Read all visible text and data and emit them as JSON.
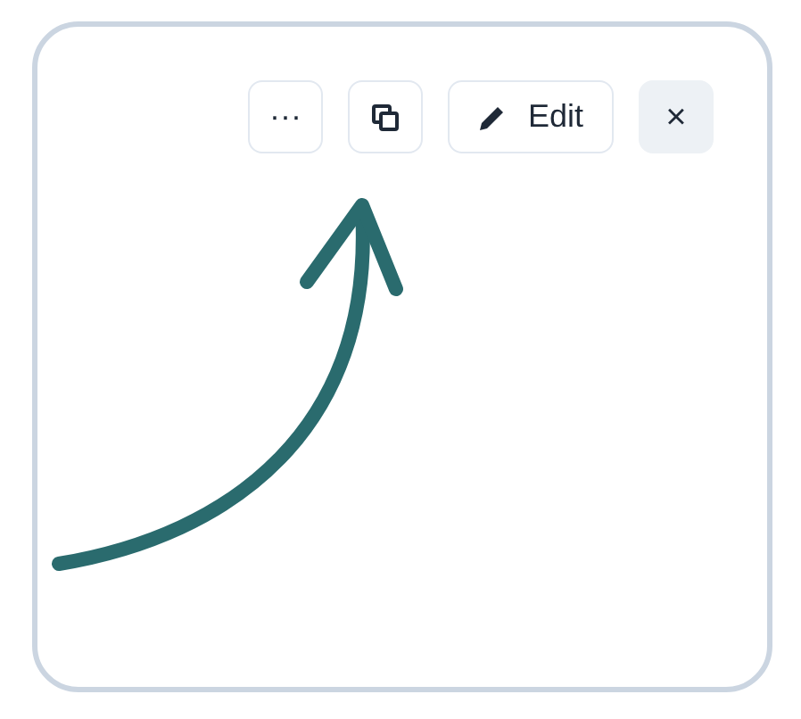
{
  "toolbar": [
    {
      "kind": "more",
      "label": "···"
    },
    {
      "kind": "copy"
    },
    {
      "kind": "edit",
      "label": "Edit"
    },
    {
      "kind": "close",
      "label": "×"
    }
  ]
}
